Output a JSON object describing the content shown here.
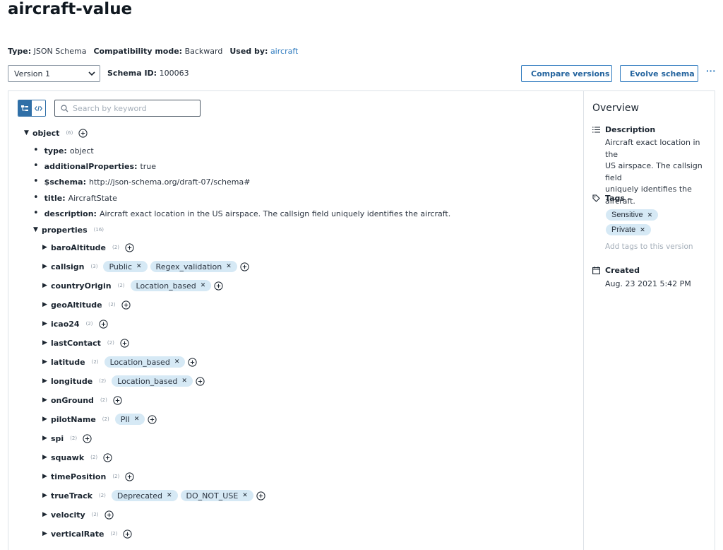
{
  "page": {
    "title": "aircraft-value"
  },
  "meta": {
    "type_label": "Type:",
    "type_value": "JSON Schema",
    "compat_label": "Compatibility mode:",
    "compat_value": "Backward",
    "usedby_label": "Used by:",
    "usedby_value": "aircraft"
  },
  "toolbar": {
    "version_selected": "Version 1",
    "schema_id_label": "Schema ID:",
    "schema_id_value": "100063",
    "compare_label": "Compare versions",
    "evolve_label": "Evolve schema",
    "more_label": "···"
  },
  "search": {
    "placeholder": "Search by keyword"
  },
  "tree": {
    "root": {
      "key": "object",
      "count": "(6)"
    },
    "fields": [
      {
        "key": "type:",
        "value": "object"
      },
      {
        "key": "additionalProperties:",
        "value": "true"
      },
      {
        "key": "$schema:",
        "value": "http://json-schema.org/draft-07/schema#"
      },
      {
        "key": "title:",
        "value": "AircraftState"
      },
      {
        "key": "description:",
        "value": "Aircraft exact location in the US airspace. The callsign field uniquely identifies the aircraft."
      }
    ],
    "properties": {
      "key": "properties",
      "count": "(16)"
    },
    "items": [
      {
        "name": "baroAltitude",
        "count": "(2)",
        "tags": []
      },
      {
        "name": "callsign",
        "count": "(3)",
        "tags": [
          "Public",
          "Regex_validation"
        ]
      },
      {
        "name": "countryOrigin",
        "count": "(2)",
        "tags": [
          "Location_based"
        ]
      },
      {
        "name": "geoAltitude",
        "count": "(2)",
        "tags": []
      },
      {
        "name": "icao24",
        "count": "(2)",
        "tags": []
      },
      {
        "name": "lastContact",
        "count": "(2)",
        "tags": []
      },
      {
        "name": "latitude",
        "count": "(2)",
        "tags": [
          "Location_based"
        ]
      },
      {
        "name": "longitude",
        "count": "(2)",
        "tags": [
          "Location_based"
        ]
      },
      {
        "name": "onGround",
        "count": "(2)",
        "tags": []
      },
      {
        "name": "pilotName",
        "count": "(2)",
        "tags": [
          "PII"
        ]
      },
      {
        "name": "spi",
        "count": "(2)",
        "tags": []
      },
      {
        "name": "squawk",
        "count": "(2)",
        "tags": []
      },
      {
        "name": "timePosition",
        "count": "(2)",
        "tags": []
      },
      {
        "name": "trueTrack",
        "count": "(2)",
        "tags": [
          "Deprecated",
          "DO_NOT_USE"
        ]
      },
      {
        "name": "velocity",
        "count": "(2)",
        "tags": []
      },
      {
        "name": "verticalRate",
        "count": "(2)",
        "tags": []
      }
    ]
  },
  "overview": {
    "title": "Overview",
    "description_label": "Description",
    "description_lines": [
      "Aircraft exact location in the",
      "US airspace. The callsign field",
      "uniquely identifies the",
      "aircraft."
    ],
    "tags_label": "Tags",
    "tags": [
      "Sensitive",
      "Private"
    ],
    "add_tags_placeholder": "Add tags to this version",
    "created_label": "Created",
    "created_value": "Aug. 23 2021 5:42 PM"
  },
  "colors": {
    "accent": "#2f7bbf",
    "tag_bg": "#d6e9f5",
    "border": "#dde2e7"
  }
}
